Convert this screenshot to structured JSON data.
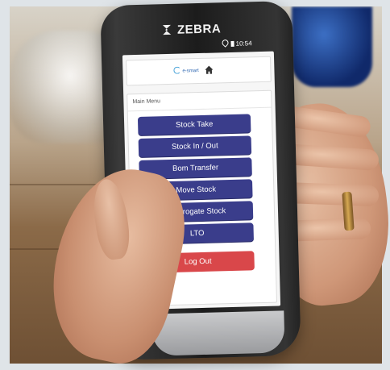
{
  "device": {
    "brand": "ZEBRA",
    "status_time": "10:54"
  },
  "app": {
    "logo_text": "e-smart",
    "section_title": "Main Menu",
    "menu_items": [
      {
        "label": "Stock Take"
      },
      {
        "label": "Stock In / Out"
      },
      {
        "label": "Bom Transfer"
      },
      {
        "label": "Move Stock"
      },
      {
        "label": "Interrogate Stock"
      },
      {
        "label": "LTO"
      }
    ],
    "logout_label": "Log Out",
    "colors": {
      "menu_button": "#3a3d8b",
      "logout_button": "#d9474a"
    }
  }
}
